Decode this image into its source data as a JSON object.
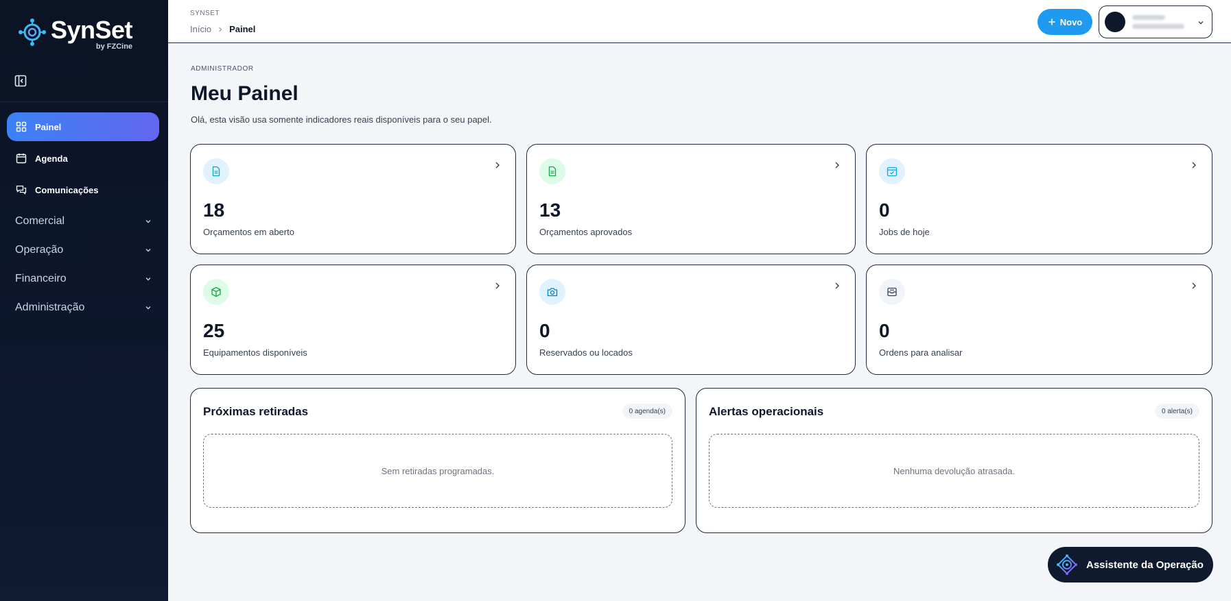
{
  "brand": {
    "name": "SynSet",
    "sub": "by FZCine"
  },
  "sidebar": {
    "items": [
      {
        "label": "Painel",
        "icon": "grid-icon",
        "active": true
      },
      {
        "label": "Agenda",
        "icon": "calendar-icon"
      },
      {
        "label": "Comunicações",
        "icon": "chat-icon"
      }
    ],
    "groups": [
      {
        "label": "Comercial"
      },
      {
        "label": "Operação"
      },
      {
        "label": "Financeiro"
      },
      {
        "label": "Administração"
      }
    ]
  },
  "header": {
    "section": "SYNSET",
    "breadcrumb": [
      "Início",
      "Painel"
    ],
    "new_button": "Novo"
  },
  "main": {
    "role": "ADMINISTRADOR",
    "title": "Meu Painel",
    "subtitle": "Olá, esta visão usa somente indicadores reais disponíveis para o seu papel.",
    "kpis": [
      {
        "value": "18",
        "label": "Orçamentos em aberto",
        "icon": "document-icon",
        "color": "#0ea5b7",
        "bg": "#e0f2fe"
      },
      {
        "value": "13",
        "label": "Orçamentos aprovados",
        "icon": "document-check-icon",
        "color": "#16a34a",
        "bg": "#dcfce7"
      },
      {
        "value": "0",
        "label": "Jobs de hoje",
        "icon": "calendar-check-icon",
        "color": "#0ea5e9",
        "bg": "#e0f2fe"
      },
      {
        "value": "25",
        "label": "Equipamentos disponíveis",
        "icon": "package-icon",
        "color": "#16a34a",
        "bg": "#dcfce7"
      },
      {
        "value": "0",
        "label": "Reservados ou locados",
        "icon": "camera-icon",
        "color": "#0284c7",
        "bg": "#e0f2fe"
      },
      {
        "value": "0",
        "label": "Ordens para analisar",
        "icon": "inbox-icon",
        "color": "#334155",
        "bg": "#f1f5f9"
      }
    ],
    "panels": [
      {
        "title": "Próximas retiradas",
        "badge": "0 agenda(s)",
        "empty": "Sem retiradas programadas."
      },
      {
        "title": "Alertas operacionais",
        "badge": "0 alerta(s)",
        "empty": "Nenhuma devolução atrasada."
      }
    ]
  },
  "assistant": {
    "label": "Assistente da Operação"
  }
}
